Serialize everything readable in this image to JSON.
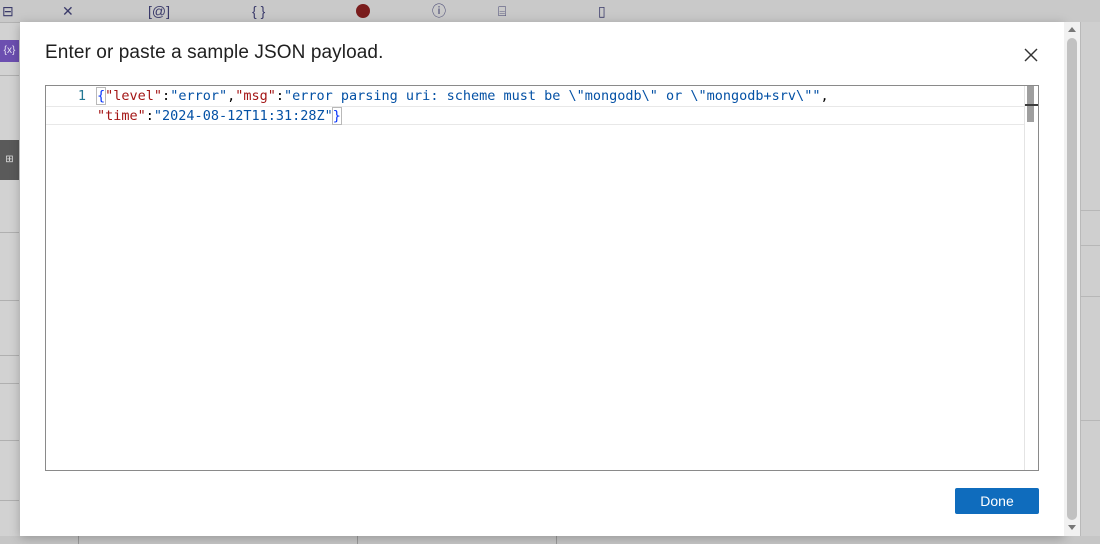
{
  "dialog": {
    "title": "Enter or paste a sample JSON payload.",
    "close_icon": "close-icon",
    "done_label": "Done"
  },
  "editor": {
    "lines": [
      {
        "number": "1",
        "tokens": [
          {
            "type": "brace",
            "text": "{"
          },
          {
            "type": "key",
            "text": "\"level\""
          },
          {
            "type": "punct",
            "text": ":"
          },
          {
            "type": "str",
            "text": "\"error\""
          },
          {
            "type": "punct",
            "text": ","
          },
          {
            "type": "key",
            "text": "\"msg\""
          },
          {
            "type": "punct",
            "text": ":"
          },
          {
            "type": "str",
            "text": "\"error parsing uri: scheme must be \\\"mongodb\\\" or \\\"mongodb+srv\\\"\""
          },
          {
            "type": "punct",
            "text": ","
          }
        ]
      },
      {
        "number": "",
        "tokens": [
          {
            "type": "key",
            "text": "\"time\""
          },
          {
            "type": "punct",
            "text": ":"
          },
          {
            "type": "str",
            "text": "\"2024-08-12T11:31:28Z\""
          },
          {
            "type": "brace",
            "text": "}"
          }
        ]
      }
    ]
  },
  "colors": {
    "primary_button": "#0f6cbd",
    "json_key": "#a31515",
    "json_string": "#0451a5",
    "line_number": "#237893"
  }
}
